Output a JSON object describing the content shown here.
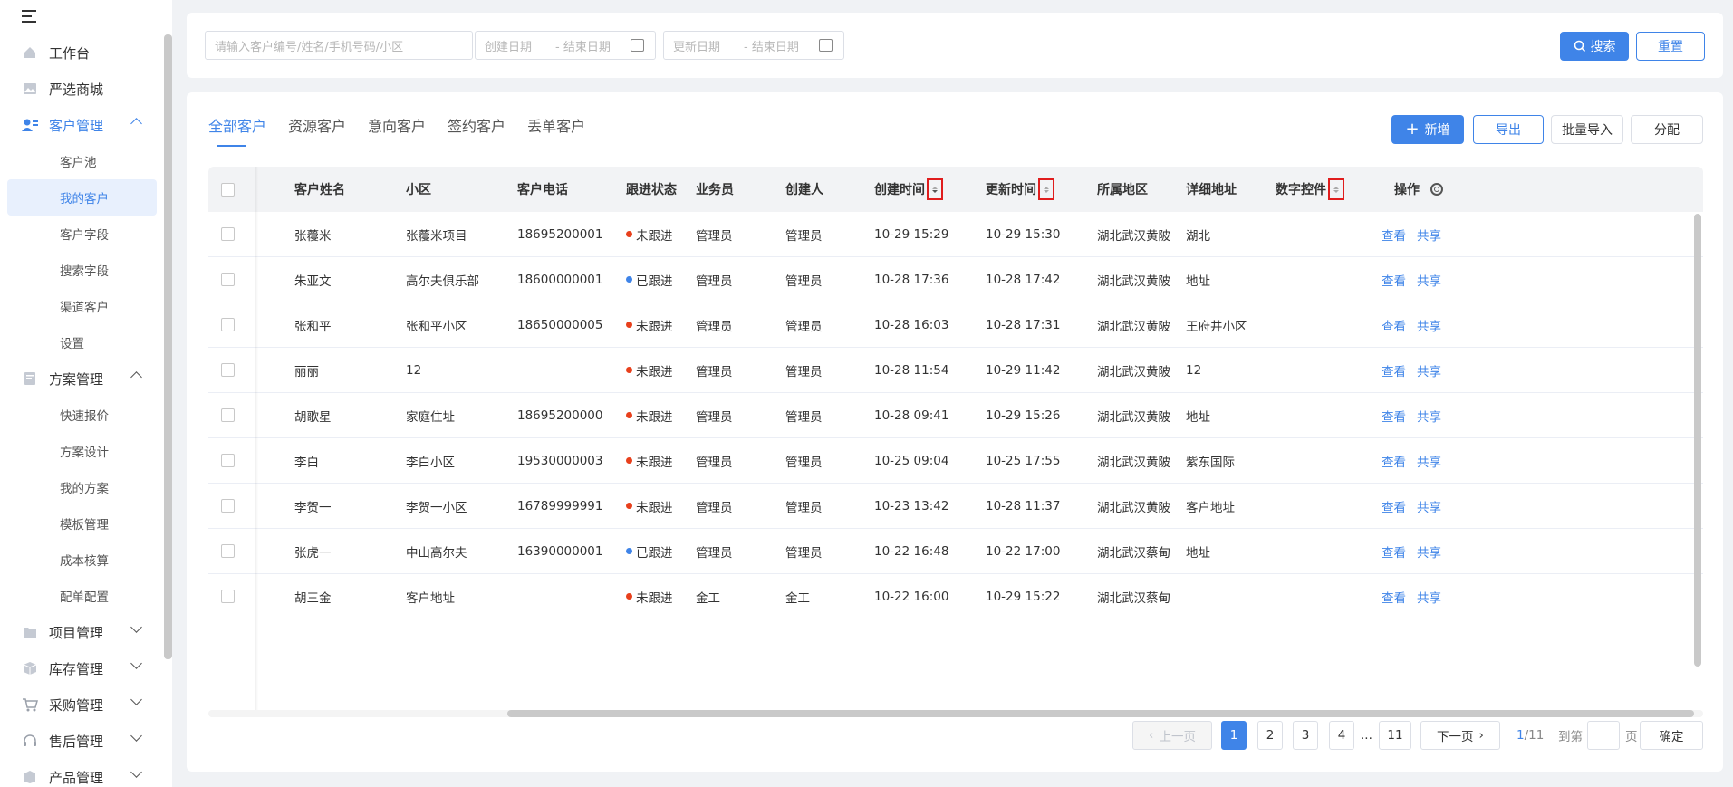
{
  "sidebar": {
    "items": [
      {
        "label": "工作台",
        "icon": "home-icon"
      },
      {
        "label": "严选商城",
        "icon": "image-icon"
      },
      {
        "label": "客户管理",
        "icon": "customer-icon",
        "expanded": true
      },
      {
        "label": "方案管理",
        "icon": "document-icon",
        "expanded": true
      },
      {
        "label": "项目管理",
        "icon": "folder-icon"
      },
      {
        "label": "库存管理",
        "icon": "box-icon"
      },
      {
        "label": "采购管理",
        "icon": "cart-icon"
      },
      {
        "label": "售后管理",
        "icon": "headset-icon"
      },
      {
        "label": "产品管理",
        "icon": "product-icon"
      }
    ],
    "customer_sub": [
      "客户池",
      "我的客户",
      "客户字段",
      "搜索字段",
      "渠道客户",
      "设置"
    ],
    "plan_sub": [
      "快速报价",
      "方案设计",
      "我的方案",
      "模板管理",
      "成本核算",
      "配单配置"
    ]
  },
  "search": {
    "keyword_placeholder": "请输入客户编号/姓名/手机号码/小区",
    "create_start": "创建日期",
    "create_end": "- 结束日期",
    "update_start": "更新日期",
    "update_end": "- 结束日期",
    "search_label": "搜索",
    "reset_label": "重置"
  },
  "tabs": [
    "全部客户",
    "资源客户",
    "意向客户",
    "签约客户",
    "丢单客户"
  ],
  "actions": {
    "add": "新增",
    "export": "导出",
    "import": "批量导入",
    "assign": "分配"
  },
  "columns": [
    "客户姓名",
    "小区",
    "客户电话",
    "跟进状态",
    "业务员",
    "创建人",
    "创建时间",
    "更新时间",
    "所属地区",
    "详细地址",
    "数字控件",
    "操作"
  ],
  "rows": [
    {
      "name": "张蘉米",
      "community": "张蘉米项目",
      "phone": "18695200001",
      "status": "未跟进",
      "sales": "管理员",
      "creator": "管理员",
      "created": "10-29 15:29",
      "updated": "10-29 15:30",
      "region": "湖北武汉黄陂",
      "address": "湖北"
    },
    {
      "name": "朱亚文",
      "community": "高尔夫俱乐部",
      "phone": "18600000001",
      "status": "已跟进",
      "sales": "管理员",
      "creator": "管理员",
      "created": "10-28 17:36",
      "updated": "10-28 17:42",
      "region": "湖北武汉黄陂",
      "address": "地址"
    },
    {
      "name": "张和平",
      "community": "张和平小区",
      "phone": "18650000005",
      "status": "未跟进",
      "sales": "管理员",
      "creator": "管理员",
      "created": "10-28 16:03",
      "updated": "10-28 17:31",
      "region": "湖北武汉黄陂",
      "address": "王府井小区"
    },
    {
      "name": "丽丽",
      "community": "12",
      "phone": "",
      "status": "未跟进",
      "sales": "管理员",
      "creator": "管理员",
      "created": "10-28 11:54",
      "updated": "10-29 11:42",
      "region": "湖北武汉黄陂",
      "address": "12"
    },
    {
      "name": "胡歌星",
      "community": "家庭住址",
      "phone": "18695200000",
      "status": "未跟进",
      "sales": "管理员",
      "creator": "管理员",
      "created": "10-28 09:41",
      "updated": "10-29 15:26",
      "region": "湖北武汉黄陂",
      "address": "地址"
    },
    {
      "name": "李白",
      "community": "李白小区",
      "phone": "19530000003",
      "status": "未跟进",
      "sales": "管理员",
      "creator": "管理员",
      "created": "10-25 09:04",
      "updated": "10-25 17:55",
      "region": "湖北武汉黄陂",
      "address": "紫东国际"
    },
    {
      "name": "李贺一",
      "community": "李贺一小区",
      "phone": "16789999991",
      "status": "未跟进",
      "sales": "管理员",
      "creator": "管理员",
      "created": "10-23 13:42",
      "updated": "10-28 11:37",
      "region": "湖北武汉黄陂",
      "address": "客户地址"
    },
    {
      "name": "张虎一",
      "community": "中山高尔夫",
      "phone": "16390000001",
      "status": "已跟进",
      "sales": "管理员",
      "creator": "管理员",
      "created": "10-22 16:48",
      "updated": "10-22 17:00",
      "region": "湖北武汉蔡甸",
      "address": "地址"
    },
    {
      "name": "胡三金",
      "community": "客户地址",
      "phone": "",
      "status": "未跟进",
      "sales": "金工",
      "creator": "金工",
      "created": "10-22 16:00",
      "updated": "10-29 15:22",
      "region": "湖北武汉蔡甸",
      "address": ""
    }
  ],
  "row_actions": {
    "view": "查看",
    "share": "共享"
  },
  "status_colors": {
    "未跟进": "#e8401c",
    "已跟进": "#3f84e8"
  },
  "pagination": {
    "prev": "上一页",
    "next": "下一页",
    "pages": [
      "1",
      "2",
      "3",
      "4",
      "...",
      "11"
    ],
    "current": "1",
    "total": "/11",
    "goto_label": "到第",
    "page_unit": "页",
    "confirm": "确定"
  },
  "colors": {
    "accent": "#3f84e8",
    "highlight_box": "#e01d1d"
  }
}
